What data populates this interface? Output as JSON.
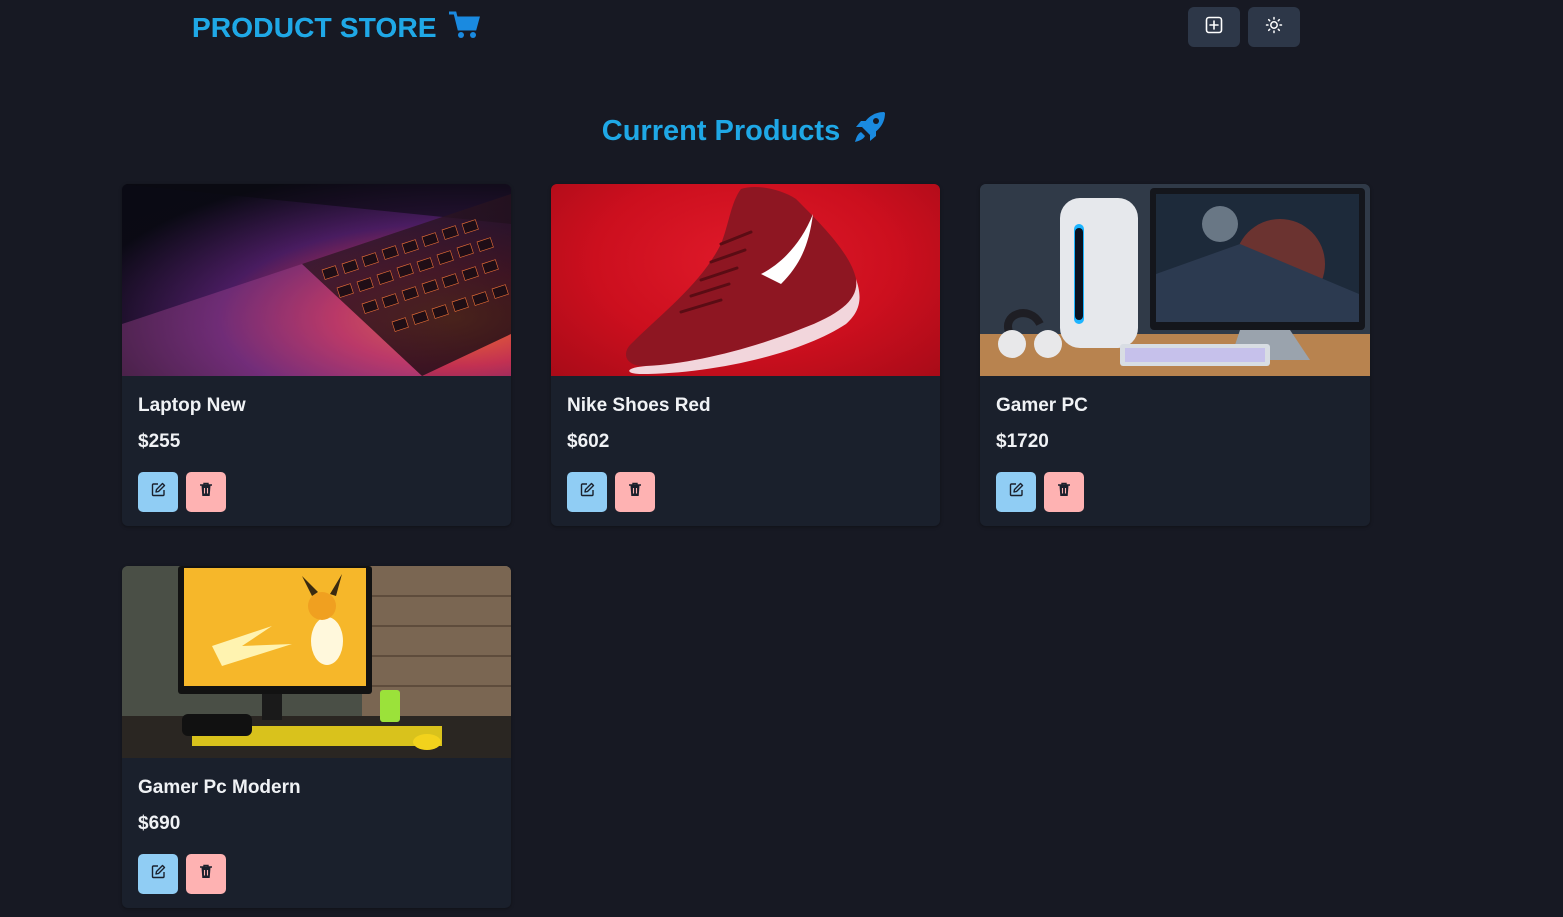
{
  "navbar": {
    "brand": "PRODUCT STORE",
    "brand_icon": "cart-icon",
    "add_icon": "plus-square-icon",
    "theme_icon": "sun-icon"
  },
  "main": {
    "title": "Current Products",
    "title_icon": "rocket-icon"
  },
  "products": [
    {
      "name": "Laptop New",
      "price": "$255",
      "image": "laptop"
    },
    {
      "name": "Nike Shoes Red",
      "price": "$602",
      "image": "red sneaker"
    },
    {
      "name": "Gamer PC",
      "price": "$1720",
      "image": "gaming pc with monitor"
    },
    {
      "name": "Gamer Pc Modern",
      "price": "$690",
      "image": "monitor with yellow wallpaper"
    }
  ],
  "colors": {
    "background": "#171923",
    "card": "#1a202c",
    "accent": "#1fa8e6",
    "edit_button": "#90cdf4",
    "delete_button": "#feb2b2",
    "nav_button": "#2d3748"
  }
}
